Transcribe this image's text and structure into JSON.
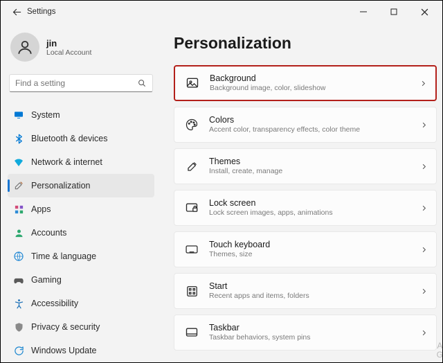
{
  "window_title": "Settings",
  "user": {
    "name": "jin",
    "subtitle": "Local Account"
  },
  "search": {
    "placeholder": "Find a setting"
  },
  "nav": [
    {
      "key": "system",
      "label": "System"
    },
    {
      "key": "bluetooth",
      "label": "Bluetooth & devices"
    },
    {
      "key": "network",
      "label": "Network & internet"
    },
    {
      "key": "personalization",
      "label": "Personalization",
      "selected": true
    },
    {
      "key": "apps",
      "label": "Apps"
    },
    {
      "key": "accounts",
      "label": "Accounts"
    },
    {
      "key": "time",
      "label": "Time & language"
    },
    {
      "key": "gaming",
      "label": "Gaming"
    },
    {
      "key": "accessibility",
      "label": "Accessibility"
    },
    {
      "key": "privacy",
      "label": "Privacy & security"
    },
    {
      "key": "update",
      "label": "Windows Update"
    }
  ],
  "page": {
    "title": "Personalization",
    "items": [
      {
        "key": "background",
        "title": "Background",
        "sub": "Background image, color, slideshow",
        "highlighted": true
      },
      {
        "key": "colors",
        "title": "Colors",
        "sub": "Accent color, transparency effects, color theme"
      },
      {
        "key": "themes",
        "title": "Themes",
        "sub": "Install, create, manage"
      },
      {
        "key": "lockscreen",
        "title": "Lock screen",
        "sub": "Lock screen images, apps, animations"
      },
      {
        "key": "touchkeyboard",
        "title": "Touch keyboard",
        "sub": "Themes, size"
      },
      {
        "key": "start",
        "title": "Start",
        "sub": "Recent apps and items, folders"
      },
      {
        "key": "taskbar",
        "title": "Taskbar",
        "sub": "Taskbar behaviors, system pins"
      }
    ]
  },
  "icons": {
    "nav": {
      "system": "<svg width='16' height='16' viewBox='0 0 24 24'><rect x='3' y='5' width='18' height='11' rx='1.5' fill='#0078d4'/><rect x='9' y='18' width='6' height='1.4' fill='#0078d4'/></svg>",
      "bluetooth": "<svg width='15' height='15' viewBox='0 0 24 24'><path d='M6 7l12 10-6 5V2l6 5L6 17' fill='none' stroke='#0078d4' stroke-width='2.2' stroke-linejoin='round' stroke-linecap='round'/></svg>",
      "network": "<svg width='16' height='16' viewBox='0 0 24 24'><path d='M12 21l9-12c-5-5-13-5-18 0l9 12z' fill='#10aadc'/></svg>",
      "personalization": "<svg width='16' height='16' viewBox='0 0 24 24'><path d='M14 6l4 4-9 9H5v-4l9-9z' fill='none' stroke='#6e6e6e' stroke-width='1.6'/><path d='M16 4l4 4' stroke='#b06a3a' stroke-width='2' fill='none'/></svg>",
      "apps": "<svg width='15' height='15' viewBox='0 0 24 24'><rect x='3' y='3' width='7' height='7' fill='#d24b78'/><rect x='14' y='3' width='7' height='7' fill='#8454c8'/><rect x='3' y='14' width='7' height='7' fill='#2e8cd6'/><rect x='14' y='14' width='7' height='7' fill='#2da86f'/></svg>",
      "accounts": "<svg width='15' height='15' viewBox='0 0 24 24'><circle cx='12' cy='8' r='4' fill='#2da86f'/><path d='M4 21c0-4 4-6 8-6s8 2 8 6' fill='#2da86f'/></svg>",
      "time": "<svg width='16' height='16' viewBox='0 0 24 24'><circle cx='12' cy='12' r='9' fill='none' stroke='#1e86d4' stroke-width='1.8'/><path d='M3 12h18M12 3c3 3 3 15 0 18M12 3c-3 3-3 15 0 18' fill='none' stroke='#1e86d4' stroke-width='1.2'/></svg>",
      "gaming": "<svg width='17' height='17' viewBox='0 0 24 24'><path d='M6 8h12c3 0 4 3 4 6s-1 5-3 5c-2 0-3-3-5-3h-4c-2 0-3 3-5 3s-3-2-3-5 1-6 4-6z' fill='#5a5a5a'/></svg>",
      "accessibility": "<svg width='15' height='15' viewBox='0 0 24 24'><circle cx='12' cy='4' r='2.3' fill='#2173b8'/><path d='M4 8l8 2 8-2M12 10v6m0 0l-4 6m4-6l4 6' stroke='#2173b8' stroke-width='2' fill='none' stroke-linecap='round'/></svg>",
      "privacy": "<svg width='15' height='15' viewBox='0 0 24 24'><path d='M12 2l8 3v6c0 5-3.5 9-8 11-4.5-2-8-6-8-11V5l8-3z' fill='#8a8a8a'/></svg>",
      "update": "<svg width='15' height='15' viewBox='0 0 24 24'><path d='M21 12a9 9 0 1 1-3-6.7L21 3v6h-6' fill='none' stroke='#1e88d0' stroke-width='2' stroke-linecap='round' stroke-linejoin='round'/></svg>"
    },
    "rows": {
      "background": "<svg width='20' height='20' viewBox='0 0 24 24' fill='none' stroke='#2b2b2b' stroke-width='1.6'><rect x='3' y='4' width='18' height='15' rx='2'/><circle cx='9' cy='10' r='1.6'/><path d='M3 17l5-5 4 4 3-3 6 6'/></svg>",
      "colors": "<svg width='20' height='20' viewBox='0 0 24 24' fill='none' stroke='#2b2b2b' stroke-width='1.5'><path d='M12 3c5 0 9 3.5 9 8 0 3-2 4-4 4h-2c-1.2 0-2 .8-2 2 0 .8.4 1.3.4 2 0 1-1 2-2.4 2C6 21 3 17 3 12s4-9 9-9z'/><circle cx='7.5' cy='10' r='1'/><circle cx='11' cy='7' r='1'/><circle cx='15.5' cy='8.2' r='1'/><circle cx='17' cy='12' r='1'/></svg>",
      "themes": "<svg width='19' height='19' viewBox='0 0 24 24' fill='none' stroke='#2b2b2b' stroke-width='1.6'><path d='M14 6l4 4-9 9H5v-4l9-9z'/><path d='M15.5 4.5l4 4'/></svg>",
      "lockscreen": "<svg width='20' height='20' viewBox='0 0 24 24' fill='none' stroke='#2b2b2b' stroke-width='1.6'><rect x='3' y='5' width='18' height='13' rx='2'/><rect x='14.2' y='12.3' width='7' height='6' rx='1' fill='#f9f9f9'/><path d='M15.8 12.3v-1.4a1.9 1.9 0 0 1 3.8 0v1.4'/></svg>",
      "touchkeyboard": "<svg width='20' height='20' viewBox='0 0 24 24' fill='none' stroke='#2b2b2b' stroke-width='1.5'><rect x='2.5' y='6' width='19' height='12' rx='2'/><path d='M6 10h.01M9.5 10h.01M13 10h.01M16.5 10h.01M6 13.5h.01M9.5 13.5h.01M13 13.5h.01M16.5 13.5h.01M8 16.5h8'/></svg>",
      "start": "<svg width='19' height='19' viewBox='0 0 24 24' fill='none' stroke='#2b2b2b' stroke-width='1.6'><rect x='3.5' y='3.5' width='17' height='17' rx='2'/><rect x='7' y='7' width='3' height='3'/><rect x='14' y='7' width='3' height='3'/><rect x='7' y='14' width='3' height='3'/><rect x='14' y='14' width='3' height='3'/></svg>",
      "taskbar": "<svg width='20' height='20' viewBox='0 0 24 24' fill='none' stroke='#2b2b2b' stroke-width='1.6'><rect x='3' y='5' width='18' height='13' rx='2'/><path d='M3 14.5h18'/></svg>"
    },
    "chevron_right": "<svg width='11' height='11' viewBox='0 0 24 24' fill='none' stroke='currentColor' stroke-width='2.3'><path d='M9 5l7 7-7 7'/></svg>",
    "back_arrow": "<svg width='15' height='15' viewBox='0 0 24 24' fill='none' stroke='#222' stroke-width='1.7'><path d='M11 5l-7 7 7 7M4 12h17'/></svg>",
    "search": "<svg width='14' height='14' viewBox='0 0 24 24' fill='none' stroke='#555' stroke-width='1.8'><circle cx='10.5' cy='10.5' r='6'/><path d='M20 20l-5-5'/></svg>",
    "user": "<svg width='26' height='26' viewBox='0 0 24 24' fill='none' stroke='#333' stroke-width='1.7'><circle cx='12' cy='8.5' r='4'/><path d='M4 21c0-4 4-6.5 8-6.5s8 2.5 8 6.5'/></svg>",
    "minimize": "<svg width='10' height='10' viewBox='0 0 10 10'><path d='M0 5h10' stroke='#222' stroke-width='1'/></svg>",
    "maximize": "<svg width='10' height='10' viewBox='0 0 10 10'><rect x='1' y='1' width='8' height='8' fill='none' stroke='#222' stroke-width='1'/></svg>",
    "close": "<svg width='11' height='11' viewBox='0 0 10 10'><path d='M1 1l8 8M9 1l-8 8' stroke='#222' stroke-width='1.1'/></svg>"
  }
}
